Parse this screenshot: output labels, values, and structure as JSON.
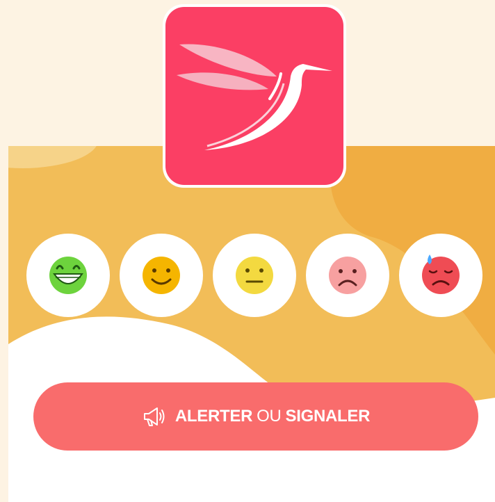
{
  "app": {
    "logo_icon": "hummingbird-logo-icon",
    "brand_color": "#fb3f64"
  },
  "colors": {
    "page_bg": "#fdf3e3",
    "card_yellow": "#f2bd58",
    "card_orange": "#f0ad42",
    "button": "#f96c6c"
  },
  "moods": [
    {
      "name": "very-happy",
      "icon": "grinning-face-icon",
      "color": "#6dd33d"
    },
    {
      "name": "happy",
      "icon": "smiling-face-icon",
      "color": "#f5b500"
    },
    {
      "name": "neutral",
      "icon": "neutral-face-icon",
      "color": "#f3d940"
    },
    {
      "name": "sad",
      "icon": "frowning-face-icon",
      "color": "#f7a0a0"
    },
    {
      "name": "very-sad",
      "icon": "sweating-sad-face-icon",
      "color": "#ef4c54"
    }
  ],
  "alert_button": {
    "icon": "megaphone-icon",
    "label_part1": "ALERTER",
    "label_part2": "OU",
    "label_part3": "SIGNALER"
  }
}
